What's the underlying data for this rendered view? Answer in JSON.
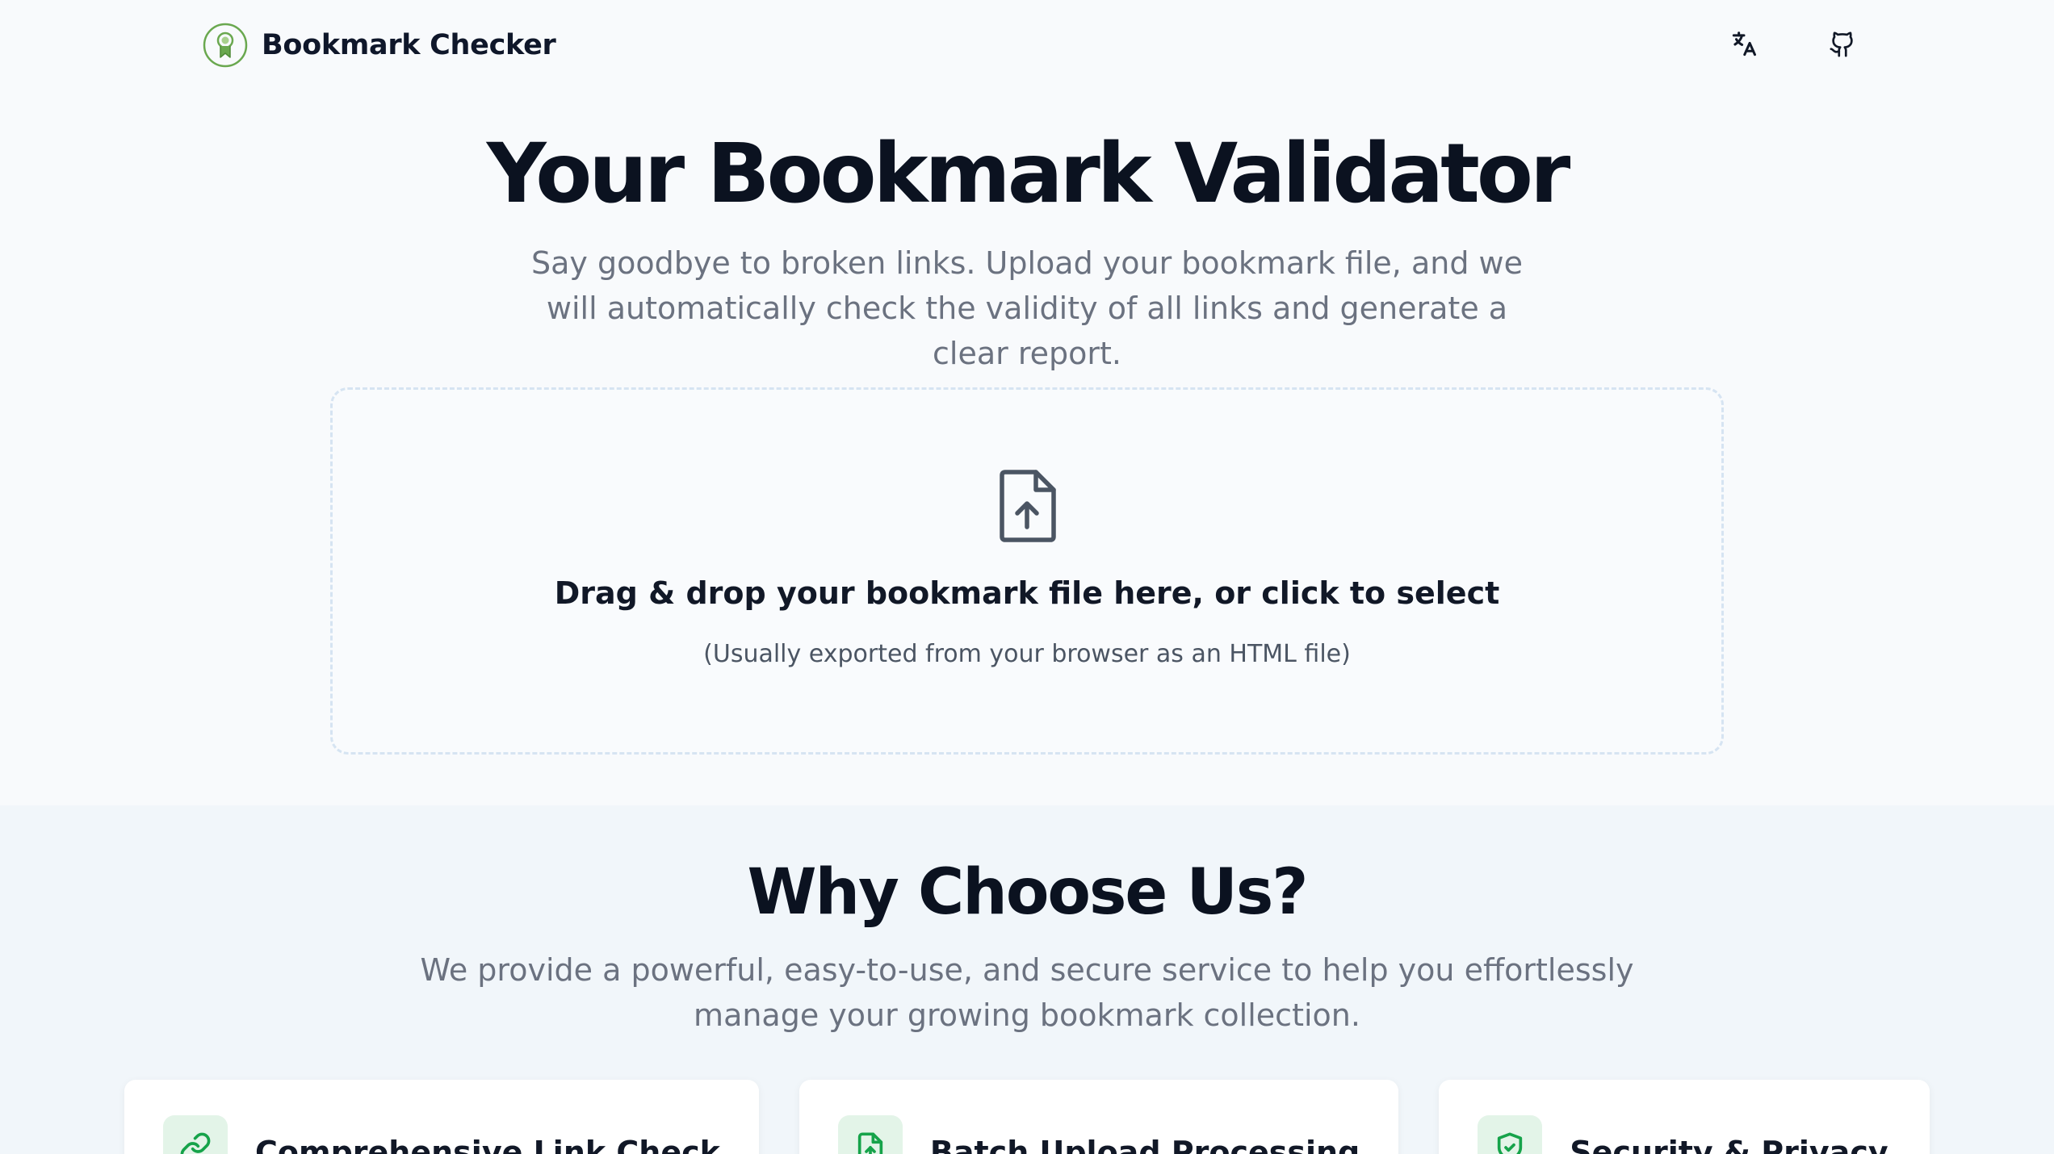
{
  "header": {
    "brand_name": "Bookmark Checker",
    "logo_icon": "award-ribbon-icon",
    "actions": [
      {
        "icon": "translate-icon"
      },
      {
        "icon": "github-icon"
      }
    ]
  },
  "hero": {
    "title": "Your Bookmark Validator",
    "subtitle": "Say goodbye to broken links. Upload your bookmark file, and we will automatically check the validity of all links and generate a clear report."
  },
  "dropzone": {
    "icon": "file-upload-icon",
    "title": "Drag & drop your bookmark file here, or click to select",
    "hint": "(Usually exported from your browser as an HTML file)"
  },
  "features": {
    "title": "Why Choose Us?",
    "subtitle": "We provide a powerful, easy-to-use, and secure service to help you effortlessly manage your growing bookmark collection.",
    "cards": [
      {
        "icon": "link-icon",
        "title": "Comprehensive Link Check"
      },
      {
        "icon": "file-stack-icon",
        "title": "Batch Upload Processing"
      },
      {
        "icon": "shield-check-icon",
        "title": "Security & Privacy"
      }
    ]
  },
  "colors": {
    "accent_green": "#16a34a",
    "logo_green": "#6aa84f",
    "text_dark": "#0f172a",
    "text_muted": "#6b7280",
    "dropzone_border": "#d6e4f2",
    "icon_tile": "#e3f4e8"
  }
}
